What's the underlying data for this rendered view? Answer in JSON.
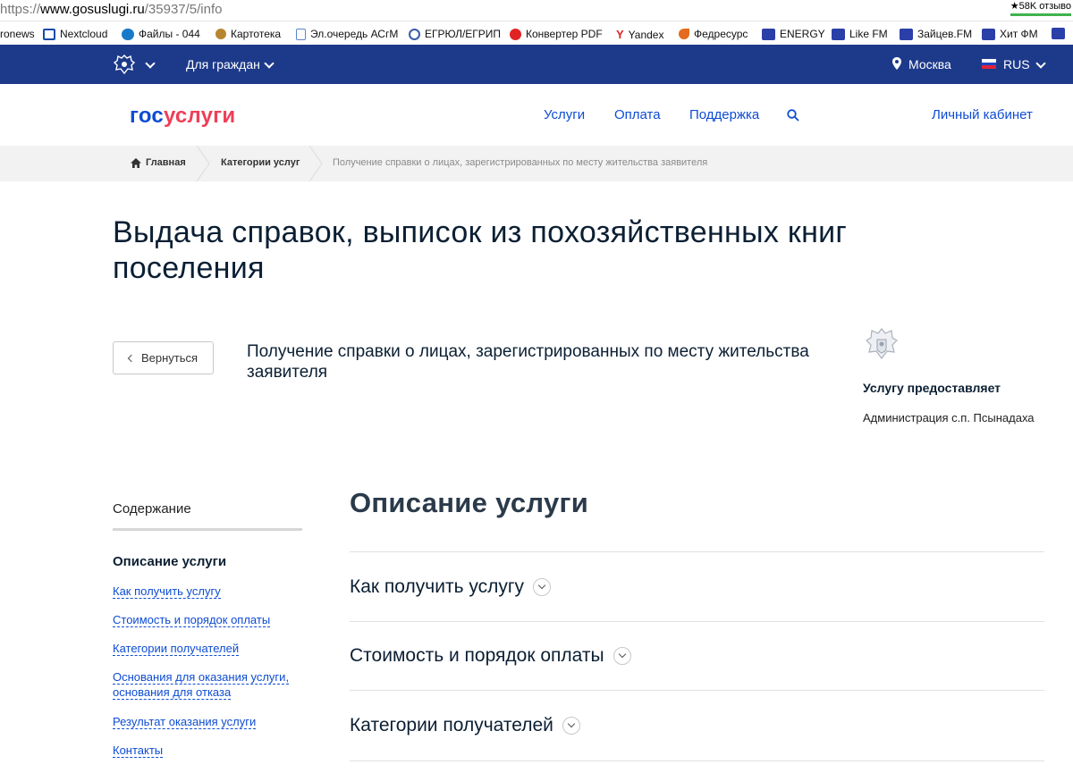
{
  "browser": {
    "url_prefix": "https://",
    "url_host": "www.gosuslugi.ru",
    "url_path": "/35937/5/info",
    "reviews_badge": "★58K отзыво"
  },
  "bookmarks": [
    {
      "label": "ronews",
      "icon": "generic",
      "color": "#ffffff"
    },
    {
      "label": "Nextcloud",
      "icon": "folder-icon",
      "color": "#1a4aa8"
    },
    {
      "label": "Файлы - 044",
      "icon": "cloud-icon",
      "color": "#1979c9"
    },
    {
      "label": "Картотека",
      "icon": "emblem-icon",
      "color": "#b8852f"
    },
    {
      "label": "Эл.очередь АСгМ",
      "icon": "doc-icon",
      "color": "#5a86c9"
    },
    {
      "label": "ЕГРЮЛ/ЕГРИП",
      "icon": "emblem-icon",
      "color": "#3a5ca8"
    },
    {
      "label": "Конвертер PDF",
      "icon": "pdf-icon",
      "color": "#e02424"
    },
    {
      "label": "Yandex",
      "icon": "yandex-icon",
      "color": "#e02424"
    },
    {
      "label": "Федресурс",
      "icon": "fedresurs-icon",
      "color": "#e56a1e"
    },
    {
      "label": "ENERGY",
      "icon": "radio-icon",
      "color": "#2b3fa8"
    },
    {
      "label": "Like FM",
      "icon": "radio-icon",
      "color": "#2b3fa8"
    },
    {
      "label": "Зайцев.FM",
      "icon": "radio-icon",
      "color": "#2b3fa8"
    },
    {
      "label": "Хит ФМ",
      "icon": "radio-icon",
      "color": "#2b3fa8"
    }
  ],
  "topnav": {
    "audience": "Для граждан",
    "city": "Москва",
    "language": "RUS",
    "background": "#1d3a8a"
  },
  "header": {
    "logo_part1": "гос",
    "logo_part2": "услуги",
    "nav": [
      "Услуги",
      "Оплата",
      "Поддержка"
    ],
    "account": "Личный кабинет"
  },
  "breadcrumbs": {
    "home": "Главная",
    "categories": "Категории услуг",
    "current": "Получение справки о лицах, зарегистрированных по месту жительства заявителя"
  },
  "page": {
    "title": "Выдача справок, выписок из похозяйственных книг поселения",
    "back_label": "Вернуться",
    "service_name": "Получение справки о лицах, зарегистрированных по месту жительства заявителя",
    "provider_title": "Услугу предоставляет",
    "provider_name": "Администрация с.п. Псынадаха"
  },
  "sidebar": {
    "title": "Содержание",
    "active": "Описание услуги",
    "links": [
      "Как получить услугу",
      "Стоимость и порядок оплаты",
      "Категории получателей",
      "Основания для оказания услуги, основания для отказа",
      "Результат оказания услуги",
      "Контакты"
    ]
  },
  "main": {
    "section_title": "Описание услуги",
    "accordion": [
      "Как получить услугу",
      "Стоимость и порядок оплаты",
      "Категории получателей"
    ]
  },
  "colors": {
    "brand_blue": "#0d4cd3",
    "brand_red": "#ee3f58",
    "nav_blue": "#1d3a8a"
  }
}
